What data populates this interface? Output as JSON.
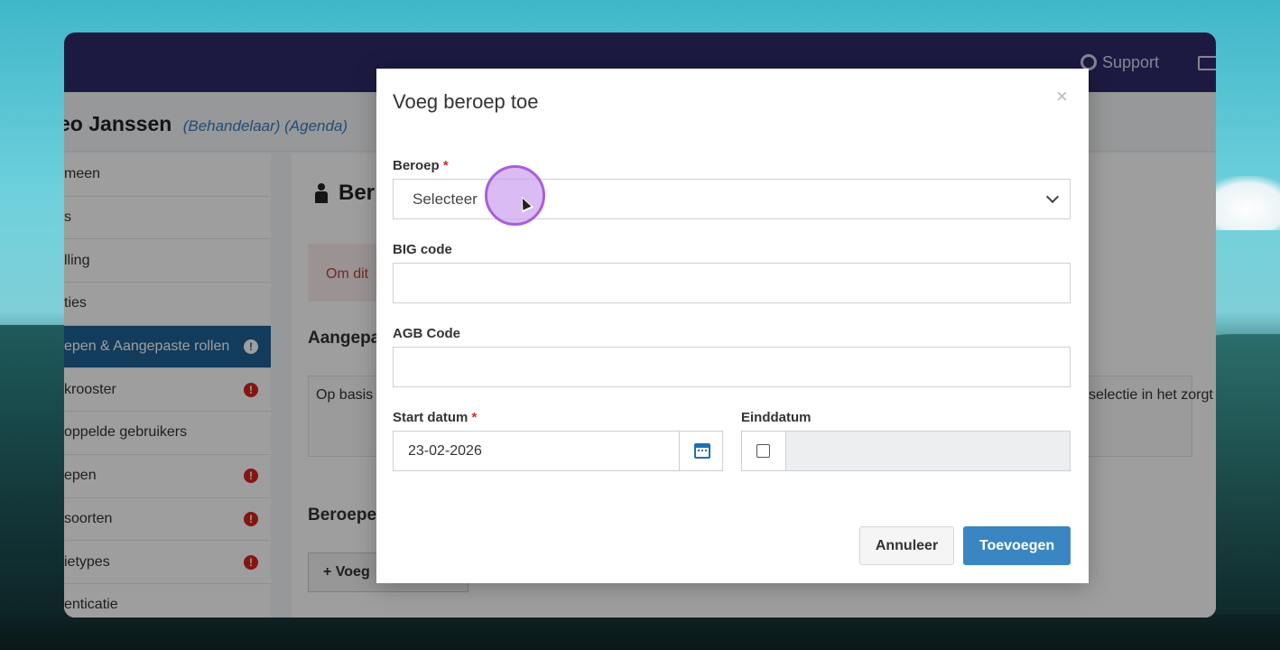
{
  "topbar": {
    "support_label": "Support"
  },
  "user": {
    "name": "eo Janssen",
    "role": "(Behandelaar) (Agenda)"
  },
  "sidebar": {
    "items": [
      {
        "label": "meen",
        "alert": false,
        "active": false
      },
      {
        "label": "s",
        "alert": false,
        "active": false
      },
      {
        "label": "lling",
        "alert": false,
        "active": false
      },
      {
        "label": "ties",
        "alert": false,
        "active": false
      },
      {
        "label": "epen & Aangepaste rollen",
        "alert": true,
        "active": true
      },
      {
        "label": "krooster",
        "alert": true,
        "active": false
      },
      {
        "label": "oppelde gebruikers",
        "alert": false,
        "active": false
      },
      {
        "label": "epen",
        "alert": true,
        "active": false
      },
      {
        "label": "soorten",
        "alert": true,
        "active": false
      },
      {
        "label": "ietypes",
        "alert": true,
        "active": false
      },
      {
        "label": "enticatie",
        "alert": false,
        "active": false
      }
    ]
  },
  "content": {
    "title": "Ber",
    "notice": "Om dit",
    "section1": "Aangepa",
    "basis_left": "Op basis",
    "basis_right": "selectie in het zorgt",
    "section2": "Beroepe",
    "add_button": "Voeg"
  },
  "modal": {
    "title": "Voeg beroep toe",
    "close": "×",
    "beroep_label": "Beroep",
    "required_mark": "*",
    "beroep_selected": "Selecteer",
    "big_label": "BIG code",
    "big_value": "",
    "agb_label": "AGB Code",
    "agb_value": "",
    "start_label": "Start datum",
    "start_value": "23-02-2026",
    "end_label": "Einddatum",
    "cancel_label": "Annuleer",
    "submit_label": "Toevoegen"
  },
  "colors": {
    "topbar": "#2f2a6b",
    "sidebar_active": "#1f5f94",
    "primary_button": "#3a86c3",
    "alert": "#d4251e",
    "cursor_highlight": "#a85fd9"
  }
}
